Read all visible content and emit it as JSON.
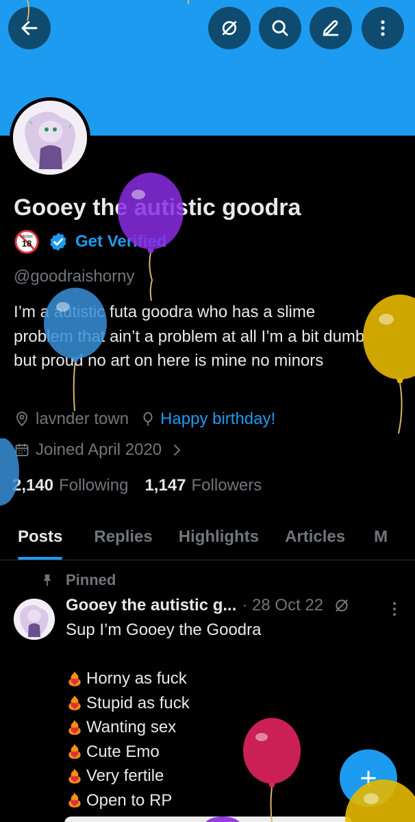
{
  "header": {
    "back_icon": "arrow-left-icon",
    "actions": [
      "mute-icon",
      "search-icon",
      "edit-icon",
      "more-vertical-icon"
    ]
  },
  "profile": {
    "name": "Gooey the autistic goodra",
    "age_badge": "18",
    "age_badge_prefix": "UNDER",
    "verify_label": "Get Verified",
    "handle": "@goodraishorny",
    "bio": "I’m a autistic futa goodra who has a slime problem that ain’t a problem at all I’m a bit dumb but proud no art on here is mine no minors",
    "location": "lavnder town",
    "birthday": "Happy birthday!",
    "joined": "Joined April 2020",
    "following_count": "2,140",
    "following_label": "Following",
    "followers_count": "1,147",
    "followers_label": "Followers"
  },
  "tabs": [
    "Posts",
    "Replies",
    "Highlights",
    "Articles",
    "M"
  ],
  "pinned_post": {
    "pinned_label": "Pinned",
    "author": "Gooey the autistic g...",
    "date": "· 28 Oct 22",
    "first_line": "Sup I’m Gooey the Goodra",
    "items": [
      "Horny as fuck",
      "Stupid as fuck",
      "Wanting sex",
      "Cute Emo",
      "Very fertile",
      "Open to RP"
    ]
  },
  "fab_label": "+",
  "colors": {
    "accent": "#1d9bf0",
    "background": "#000000",
    "muted_text": "#71767b",
    "balloon_purple": "#8a2be2",
    "balloon_blue": "#3a8fd8",
    "balloon_yellow": "#e6b800",
    "balloon_red": "#e0245e"
  }
}
